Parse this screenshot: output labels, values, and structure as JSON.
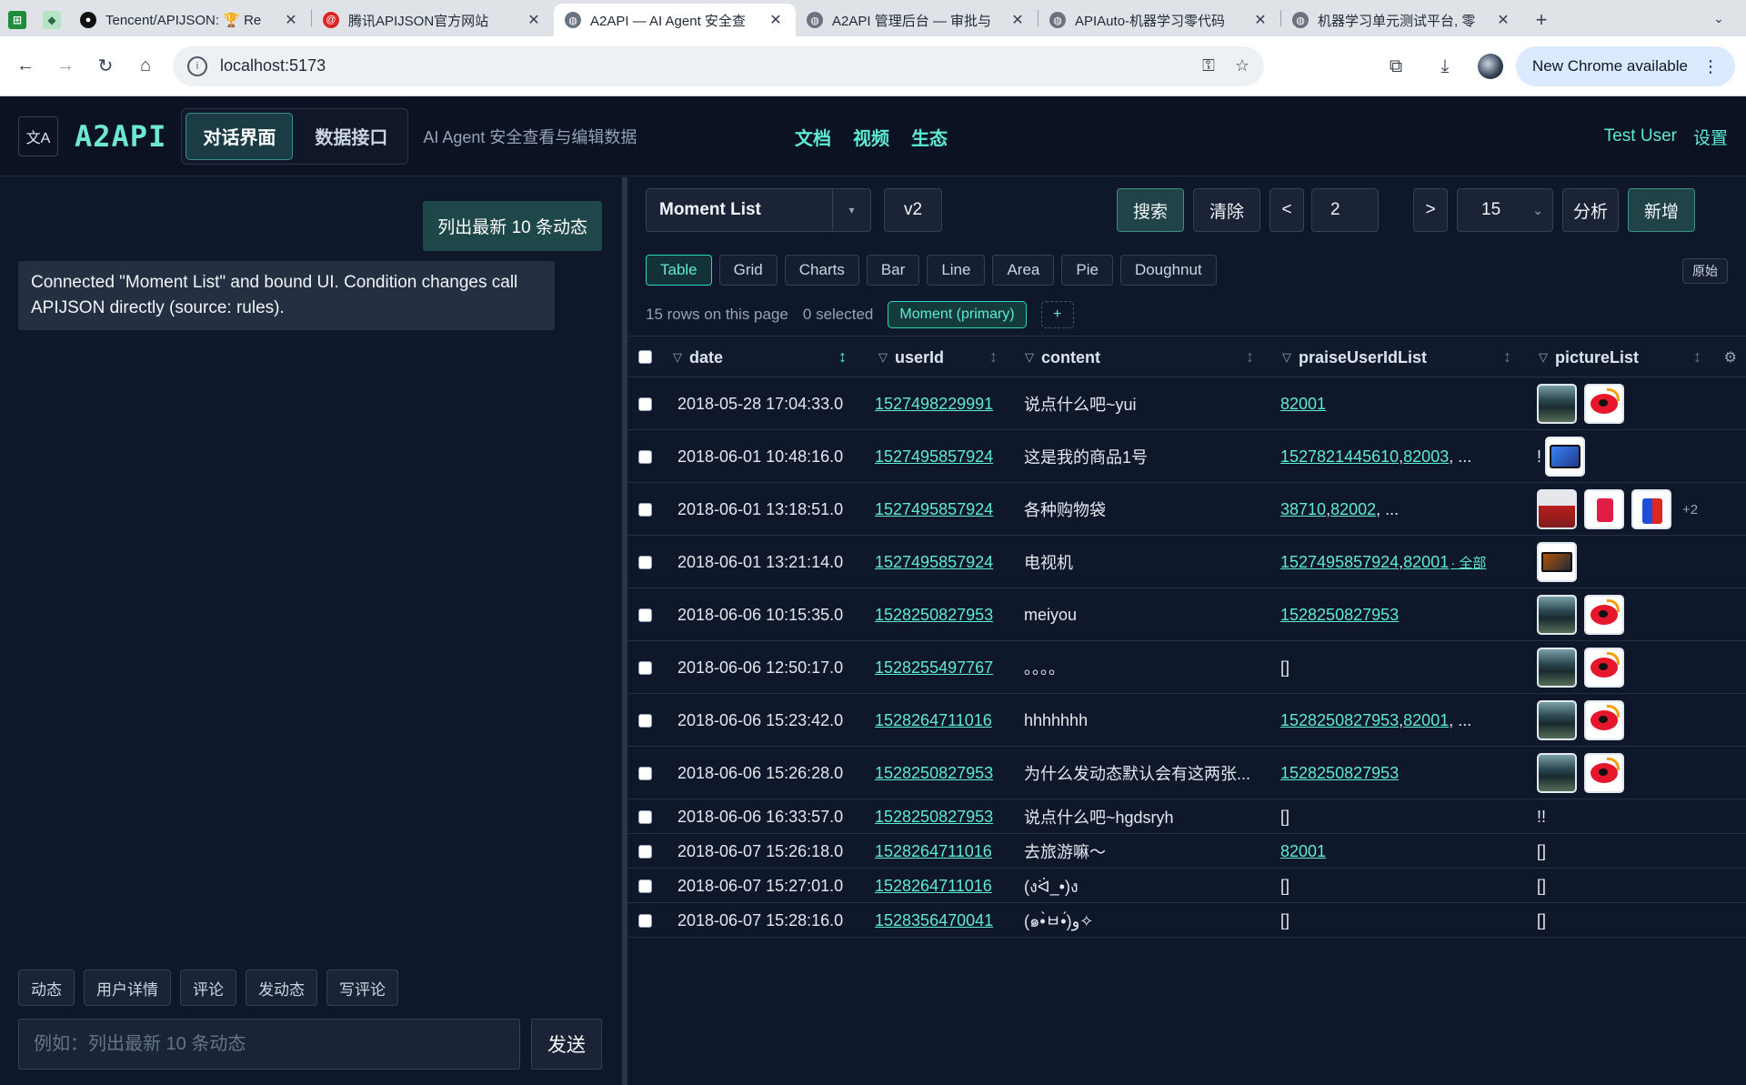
{
  "browser": {
    "tabs": [
      {
        "title": "Tencent/APIJSON: 🏆 Re",
        "favicon": "github-icon",
        "active": false
      },
      {
        "title": "腾讯APIJSON官方网站",
        "favicon": "site-icon",
        "active": false
      },
      {
        "title": "A2API — AI Agent 安全查",
        "favicon": "globe-icon",
        "active": true
      },
      {
        "title": "A2API 管理后台 — 审批与",
        "favicon": "globe-icon",
        "active": false
      },
      {
        "title": "APIAuto-机器学习零代码",
        "favicon": "globe-icon",
        "active": false
      },
      {
        "title": "机器学习单元测试平台, 零",
        "favicon": "globe-icon",
        "active": false
      }
    ],
    "url": "localhost:5173",
    "update_label": "New Chrome available"
  },
  "header": {
    "brand": "A2API",
    "modes": [
      "对话界面",
      "数据接口"
    ],
    "tagline": "AI Agent 安全查看与编辑数据",
    "nav": [
      "文档",
      "视频",
      "生态"
    ],
    "user": "Test User",
    "settings": "设置"
  },
  "chat": {
    "user_message": "列出最新 10 条动态",
    "bot_message": "Connected \"Moment List\" and bound UI. Condition changes call APIJSON directly (source: rules).",
    "quick_actions": [
      "动态",
      "用户详情",
      "评论",
      "发动态",
      "写评论"
    ],
    "input_placeholder": "例如：列出最新 10 条动态",
    "send": "发送"
  },
  "data": {
    "table_name": "Moment List",
    "version": "v2",
    "search": "搜索",
    "clear": "清除",
    "prev": "<",
    "page": "2",
    "next": ">",
    "page_size": "15",
    "analyze": "分析",
    "create": "新增",
    "views": [
      "Table",
      "Grid",
      "Charts",
      "Bar",
      "Line",
      "Area",
      "Pie",
      "Doughnut"
    ],
    "raw": "原始",
    "rows_info": "15 rows on this page",
    "selected_info": "0 selected",
    "primary_table": "Moment (primary)",
    "add_table": "+",
    "columns": [
      "date",
      "userId",
      "content",
      "praiseUserIdList",
      "pictureList"
    ],
    "rows": [
      {
        "date": "2018-05-28 17:04:33.0",
        "userId": "1527498229991",
        "content": "说点什么吧~yui",
        "praise": [
          "82001"
        ],
        "praise_more": "",
        "praise_all": "",
        "pictures": [
          "landscape",
          "weibo"
        ],
        "pic_text": ""
      },
      {
        "date": "2018-06-01 10:48:16.0",
        "userId": "1527495857924",
        "content": "这是我的商品1号",
        "praise": [
          "1527821445610",
          "82003"
        ],
        "praise_more": ", ...",
        "praise_all": "",
        "pictures": [
          "tablet"
        ],
        "pic_text": "!"
      },
      {
        "date": "2018-06-01 13:18:51.0",
        "userId": "1527495857924",
        "content": "各种购物袋",
        "praise": [
          "38710",
          "82002"
        ],
        "praise_more": ", ...",
        "praise_all": "",
        "pictures": [
          "bag1",
          "bag2",
          "bag3"
        ],
        "pic_text": "",
        "pic_more": "+2"
      },
      {
        "date": "2018-06-01 13:21:14.0",
        "userId": "1527495857924",
        "content": "电视机",
        "praise": [
          "1527495857924",
          "82001"
        ],
        "praise_more": "",
        "praise_all": "· 全部",
        "pictures": [
          "tv"
        ],
        "pic_text": ""
      },
      {
        "date": "2018-06-06 10:15:35.0",
        "userId": "1528250827953",
        "content": "meiyou",
        "praise": [
          "1528250827953"
        ],
        "praise_more": "",
        "praise_all": "",
        "pictures": [
          "landscape",
          "weibo"
        ],
        "pic_text": ""
      },
      {
        "date": "2018-06-06 12:50:17.0",
        "userId": "1528255497767",
        "content": "。。。。",
        "praise": [],
        "praise_text": "[]",
        "praise_more": "",
        "praise_all": "",
        "pictures": [
          "landscape",
          "weibo"
        ],
        "pic_text": ""
      },
      {
        "date": "2018-06-06 15:23:42.0",
        "userId": "1528264711016",
        "content": "hhhhhhh",
        "praise": [
          "1528250827953",
          "82001"
        ],
        "praise_more": ", ...",
        "praise_all": "",
        "pictures": [
          "landscape",
          "weibo"
        ],
        "pic_text": ""
      },
      {
        "date": "2018-06-06 15:26:28.0",
        "userId": "1528250827953",
        "content": "为什么发动态默认会有这两张...",
        "praise": [
          "1528250827953"
        ],
        "praise_more": "",
        "praise_all": "",
        "pictures": [
          "landscape",
          "weibo"
        ],
        "pic_text": ""
      },
      {
        "date": "2018-06-06 16:33:57.0",
        "userId": "1528250827953",
        "content": "说点什么吧~hgdsryh",
        "praise": [],
        "praise_text": "[]",
        "praise_more": "",
        "praise_all": "",
        "pictures": [],
        "pic_text": "!!"
      },
      {
        "date": "2018-06-07 15:26:18.0",
        "userId": "1528264711016",
        "content": "去旅游嘛～",
        "praise": [
          "82001"
        ],
        "praise_more": "",
        "praise_all": "",
        "pictures": [],
        "pic_text": "[]"
      },
      {
        "date": "2018-06-07 15:27:01.0",
        "userId": "1528264711016",
        "content": "(งᐛ_•)ง",
        "praise": [],
        "praise_text": "[]",
        "praise_more": "",
        "praise_all": "",
        "pictures": [],
        "pic_text": "[]"
      },
      {
        "date": "2018-06-07 15:28:16.0",
        "userId": "1528356470041",
        "content": "(๑•̀ㅂ•́)و✧",
        "praise": [],
        "praise_text": "[]",
        "praise_more": "",
        "praise_all": "",
        "pictures": [],
        "pic_text": "[]"
      }
    ]
  }
}
